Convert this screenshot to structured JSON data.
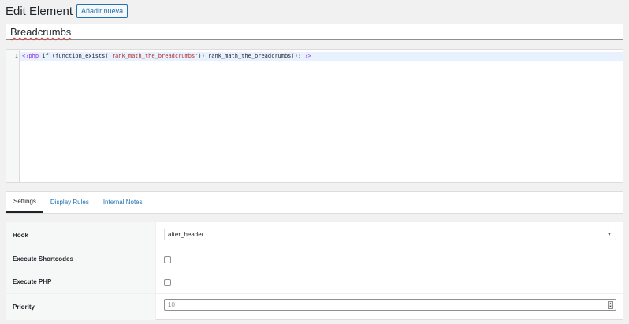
{
  "header": {
    "title": "Edit Element",
    "add_new_label": "Añadir nueva"
  },
  "element": {
    "title_value": "Breadcrumbs"
  },
  "editor": {
    "line_number": "1",
    "code_meta_open": "<?php",
    "code_part1": " if (function_exists(",
    "code_string": "'rank_math_the_breadcrumbs'",
    "code_part2": ")) rank_math_the_breadcrumbs(); ",
    "code_meta_close": "?>"
  },
  "tabs": [
    {
      "label": "Settings",
      "active": true
    },
    {
      "label": "Display Rules",
      "active": false
    },
    {
      "label": "Internal Notes",
      "active": false
    }
  ],
  "settings": {
    "hook_label": "Hook",
    "hook_value": "after_header",
    "execute_shortcodes_label": "Execute Shortcodes",
    "execute_shortcodes_checked": false,
    "execute_php_label": "Execute PHP",
    "execute_php_checked": false,
    "priority_label": "Priority",
    "priority_value": "10"
  },
  "colors": {
    "accent": "#2271b1",
    "string": "#b32d2e",
    "php_tag": "#8a2be2",
    "active_line": "#e8f2fe"
  }
}
